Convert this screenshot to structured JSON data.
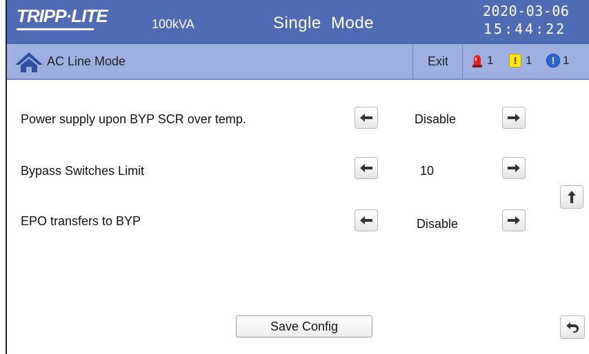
{
  "header": {
    "brand": "TRIPP·LITE",
    "capacity": "100kVA",
    "mode": "Single  Mode",
    "date": "2020-03-06",
    "time": "15:44:22"
  },
  "subheader": {
    "mode_label": "AC Line Mode",
    "exit_label": "Exit",
    "alarms": {
      "critical_count": "1",
      "warning_count": "1",
      "info_count": "1"
    }
  },
  "settings": [
    {
      "label": "Power supply upon BYP SCR over temp.",
      "value": "Disable"
    },
    {
      "label": "Bypass  Switches Limit",
      "value": "10"
    },
    {
      "label": "EPO transfers to BYP",
      "value": "Disable"
    }
  ],
  "footer": {
    "save_label": "Save Config"
  },
  "colors": {
    "header_bg": "#4e6bb3",
    "subheader_bg": "#9db0df",
    "warning": "#ffe81a",
    "info": "#2a63e0",
    "critical": "#e02020"
  },
  "icons": [
    "home-icon",
    "siren-icon",
    "warning-icon",
    "info-icon",
    "arrow-left-icon",
    "arrow-right-icon",
    "arrow-up-icon",
    "return-icon"
  ]
}
